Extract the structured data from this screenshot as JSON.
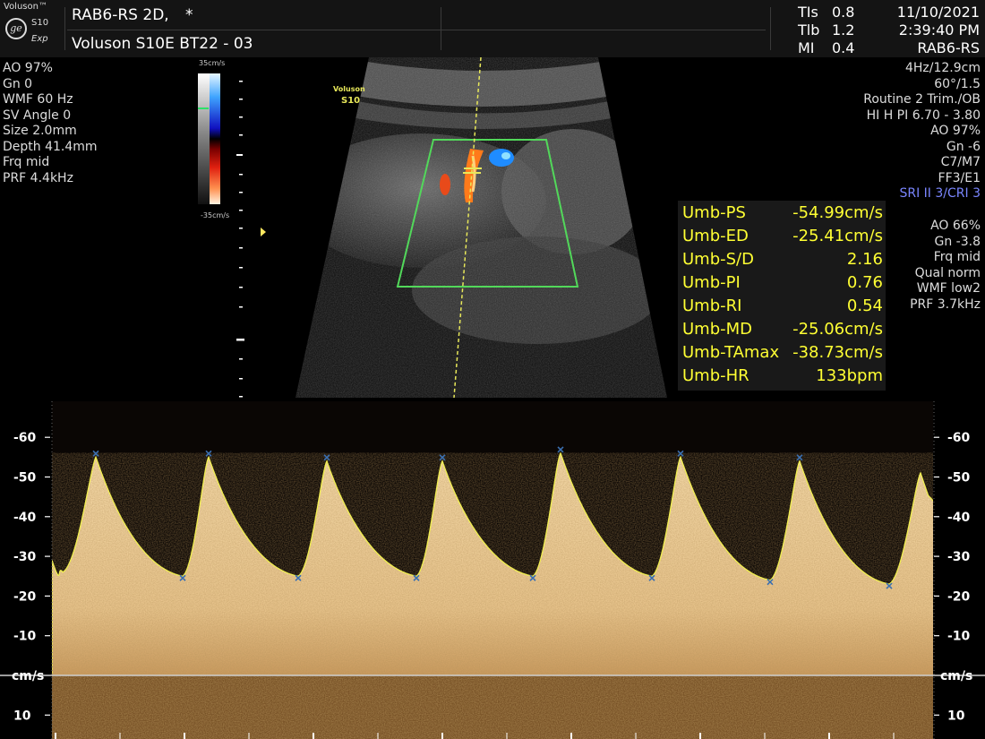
{
  "header": {
    "brand": "Voluson™",
    "brand_model": "S10",
    "brand_mode": "Exp",
    "title_line1": "RAB6-RS 2D,",
    "title_star": "*",
    "title_line2": "Voluson S10E BT22 - 03",
    "tis_label": "TIs",
    "tis_value": "0.8",
    "tib_label": "Tlb",
    "tib_value": "1.2",
    "mi_label": "MI",
    "mi_value": "0.4",
    "date": "11/10/2021",
    "time": "2:39:40 PM",
    "probe": "RAB6-RS"
  },
  "left_params": [
    "AO 97%",
    "Gn  0",
    "WMF 60 Hz",
    "SV Angle  0",
    "Size  2.0mm",
    "Depth 41.4mm",
    "Frq mid",
    "PRF  4.4kHz"
  ],
  "color_bar": {
    "top": "35cm/s",
    "bottom": "-35cm/s"
  },
  "watermark": {
    "line1": "Voluson",
    "line2": "S10"
  },
  "right_params_top": [
    "4Hz/12.9cm",
    "60°/1.5",
    "Routine 2 Trim./OB",
    "HI H PI 6.70 - 3.80",
    "AO 97%",
    "Gn  -6",
    "C7/M7",
    "FF3/E1"
  ],
  "right_params_sri": "SRI II 3/CRI 3",
  "right_params_bottom": [
    "AO 66%",
    "Gn -3.8",
    "Frq mid",
    "Qual norm",
    "WMF low2",
    "PRF  3.7kHz"
  ],
  "measurements": [
    {
      "label": "Umb-PS",
      "value": "-54.99cm/s"
    },
    {
      "label": "Umb-ED",
      "value": "-25.41cm/s"
    },
    {
      "label": "Umb-S/D",
      "value": "2.16"
    },
    {
      "label": "Umb-PI",
      "value": "0.76"
    },
    {
      "label": "Umb-RI",
      "value": "0.54"
    },
    {
      "label": "Umb-MD",
      "value": "-25.06cm/s"
    },
    {
      "label": "Umb-TAmax",
      "value": "-38.73cm/s"
    },
    {
      "label": "Umb-HR",
      "value": "133bpm"
    }
  ],
  "spectral": {
    "unit": "cm/s",
    "ticks": [
      {
        "label": "-60",
        "value": -60
      },
      {
        "label": "-50",
        "value": -50
      },
      {
        "label": "-40",
        "value": -40
      },
      {
        "label": "-30",
        "value": -30
      },
      {
        "label": "-20",
        "value": -20
      },
      {
        "label": "-10",
        "value": -10
      },
      {
        "label": "10",
        "value": 10
      }
    ],
    "peak_velocities": [
      -55,
      -55,
      -54,
      -54,
      -56,
      -55,
      -54,
      -51
    ],
    "end_diastolic_velocities": [
      -26,
      -25,
      -25,
      -25,
      -25,
      -25,
      -24,
      -23
    ],
    "colors": {
      "fill": "#e8c48c",
      "noise": "#8a5e2c",
      "trace": "#f0ee50",
      "baseline": "#cfcfcf"
    }
  },
  "colors": {
    "measure_text": "#ffff33",
    "sri_text": "#7a86ff",
    "roi_box": "#52d85a"
  }
}
